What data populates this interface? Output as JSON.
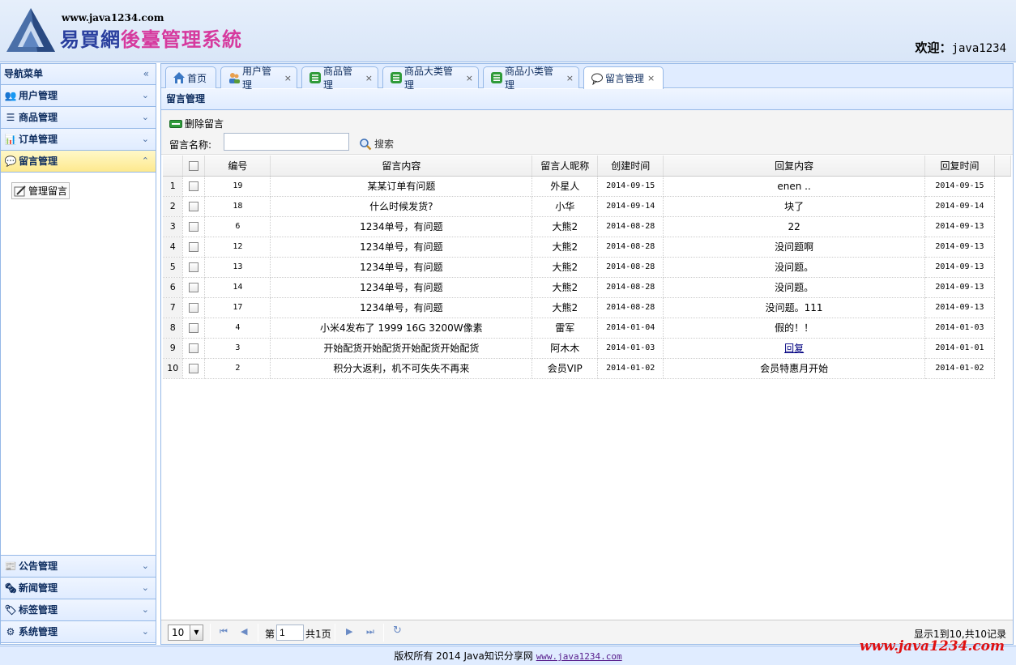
{
  "header": {
    "site_url": "www.java1234.com",
    "title_part1": "易買網",
    "title_part2": "後臺管理系統",
    "welcome_label": "欢迎：",
    "username": "java1234"
  },
  "sidebar": {
    "title": "导航菜单",
    "collapse_glyph": "«",
    "sections_top": [
      {
        "label": "用户管理",
        "icon": "users-icon",
        "glyph": "👥",
        "chev": "⌄"
      },
      {
        "label": "商品管理",
        "icon": "list-icon",
        "glyph": "☰",
        "chev": "⌄"
      },
      {
        "label": "订单管理",
        "icon": "order-icon",
        "glyph": "📊",
        "chev": "⌄"
      },
      {
        "label": "留言管理",
        "icon": "comment-icon",
        "glyph": "💬",
        "chev": "⌃"
      }
    ],
    "sub_item": "管理留言",
    "sections_bottom": [
      {
        "label": "公告管理",
        "icon": "notice-icon",
        "glyph": "📰",
        "chev": "⌄"
      },
      {
        "label": "新闻管理",
        "icon": "news-icon",
        "glyph": "🗞",
        "chev": "⌄"
      },
      {
        "label": "标签管理",
        "icon": "tag-icon",
        "glyph": "🏷",
        "chev": "⌄"
      },
      {
        "label": "系统管理",
        "icon": "gear-icon",
        "glyph": "⚙",
        "chev": "⌄"
      }
    ]
  },
  "tabs": [
    {
      "label": "首页",
      "icon": "home-icon",
      "closable": false
    },
    {
      "label": "用户管理",
      "icon": "users-icon",
      "closable": true
    },
    {
      "label": "商品管理",
      "icon": "list-icon",
      "closable": true
    },
    {
      "label": "商品大类管理",
      "icon": "list-icon",
      "closable": true
    },
    {
      "label": "商品小类管理",
      "icon": "list-icon",
      "closable": true
    },
    {
      "label": "留言管理",
      "icon": "comment-icon",
      "closable": true
    }
  ],
  "tab_close": "×",
  "panel": {
    "title": "留言管理",
    "delete_label": "删除留言",
    "search_label": "留言名称:",
    "search_value": "",
    "search_button": "搜索"
  },
  "grid": {
    "columns": [
      "编号",
      "留言内容",
      "留言人昵称",
      "创建时间",
      "回复内容",
      "回复时间"
    ],
    "rows": [
      {
        "n": "1",
        "id": "19",
        "content": "某某订单有问题",
        "nick": "外星人",
        "created": "2014-09-15",
        "reply": "enen ..",
        "replied": "2014-09-15"
      },
      {
        "n": "2",
        "id": "18",
        "content": "什么时候发货?",
        "nick": "小华",
        "created": "2014-09-14",
        "reply": "块了",
        "replied": "2014-09-14"
      },
      {
        "n": "3",
        "id": "6",
        "content": "1234单号，有问题",
        "nick": "大熊2",
        "created": "2014-08-28",
        "reply": "22",
        "replied": "2014-09-13"
      },
      {
        "n": "4",
        "id": "12",
        "content": "1234单号，有问题",
        "nick": "大熊2",
        "created": "2014-08-28",
        "reply": "没问题啊",
        "replied": "2014-09-13"
      },
      {
        "n": "5",
        "id": "13",
        "content": "1234单号，有问题",
        "nick": "大熊2",
        "created": "2014-08-28",
        "reply": "没问题。",
        "replied": "2014-09-13"
      },
      {
        "n": "6",
        "id": "14",
        "content": "1234单号，有问题",
        "nick": "大熊2",
        "created": "2014-08-28",
        "reply": "没问题。",
        "replied": "2014-09-13"
      },
      {
        "n": "7",
        "id": "17",
        "content": "1234单号，有问题",
        "nick": "大熊2",
        "created": "2014-08-28",
        "reply": "没问题。111",
        "replied": "2014-09-13"
      },
      {
        "n": "8",
        "id": "4",
        "content": "小米4发布了 1999 16G 3200W像素",
        "nick": "雷军",
        "created": "2014-01-04",
        "reply": "假的！！",
        "replied": "2014-01-03"
      },
      {
        "n": "9",
        "id": "3",
        "content": "开始配货开始配货开始配货开始配货",
        "nick": "阿木木",
        "created": "2014-01-03",
        "reply": "回复",
        "replied": "2014-01-01"
      },
      {
        "n": "10",
        "id": "2",
        "content": "积分大返利，机不可失失不再来",
        "nick": "会员VIP",
        "created": "2014-01-02",
        "reply": "会员特惠月开始",
        "replied": "2014-01-02"
      }
    ]
  },
  "pager": {
    "page_size": "10",
    "page_label_before": "第",
    "page_value": "1",
    "page_label_after": "共1页",
    "info": "显示1到10,共10记录"
  },
  "footer": {
    "text": "版权所有 2014 Java知识分享网",
    "link": "www.java1234.com"
  },
  "watermark": "www.java1234.com"
}
